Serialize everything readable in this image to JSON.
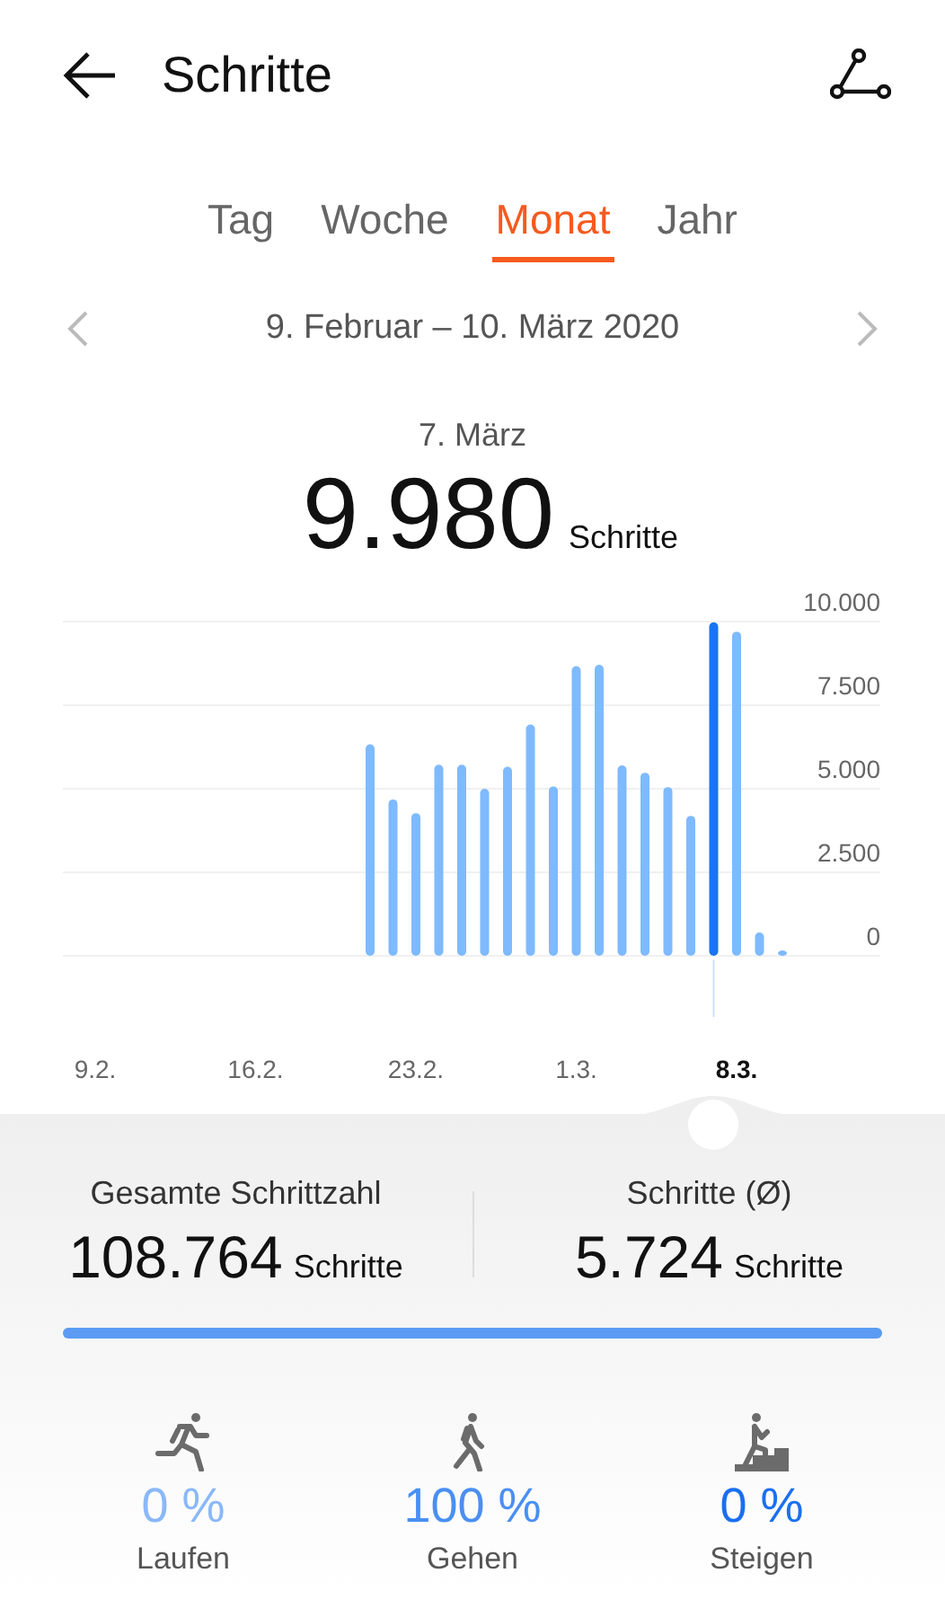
{
  "header": {
    "title": "Schritte"
  },
  "tabs": [
    {
      "label": "Tag",
      "selected": false
    },
    {
      "label": "Woche",
      "selected": false
    },
    {
      "label": "Monat",
      "selected": true
    },
    {
      "label": "Jahr",
      "selected": false
    }
  ],
  "period": "9. Februar – 10. März 2020",
  "selection": {
    "date": "7. März",
    "value": "9.980",
    "unit": "Schritte"
  },
  "chart_data": {
    "type": "bar",
    "categories": [
      "9.2.",
      null,
      null,
      null,
      null,
      null,
      null,
      "16.2.",
      null,
      null,
      null,
      null,
      null,
      null,
      "23.2.",
      null,
      null,
      null,
      null,
      null,
      null,
      "1.3.",
      null,
      null,
      null,
      null,
      null,
      null,
      "8.3.",
      null,
      null
    ],
    "values": [
      null,
      null,
      null,
      null,
      null,
      null,
      null,
      null,
      null,
      null,
      null,
      null,
      6330,
      4680,
      4270,
      5720,
      5720,
      5000,
      5660,
      6920,
      5070,
      8670,
      8710,
      5700,
      5480,
      5050,
      4190,
      9980,
      9700,
      700,
      110
    ],
    "ylim": [
      0,
      10000
    ],
    "yticks": [
      {
        "value": 0,
        "label": "0"
      },
      {
        "value": 2500,
        "label": "2.500"
      },
      {
        "value": 5000,
        "label": "5.000"
      },
      {
        "value": 7500,
        "label": "7.500"
      },
      {
        "value": 10000,
        "label": "10.000"
      }
    ],
    "grid": true
  },
  "summary": [
    {
      "label": "Gesamte Schrittzahl",
      "value": "108.764",
      "unit": "Schritte"
    },
    {
      "label": "Schritte (Ø)",
      "value": "5.724",
      "unit": "Schritte"
    }
  ],
  "activities": [
    {
      "kind": "run",
      "percent": "0 %",
      "label": "Laufen",
      "color": "#8ab8f8"
    },
    {
      "kind": "walk",
      "percent": "100 %",
      "label": "Gehen",
      "color": "#4a8ff2"
    },
    {
      "kind": "climb",
      "percent": "0 %",
      "label": "Steigen",
      "color": "#1a6ff0"
    }
  ]
}
